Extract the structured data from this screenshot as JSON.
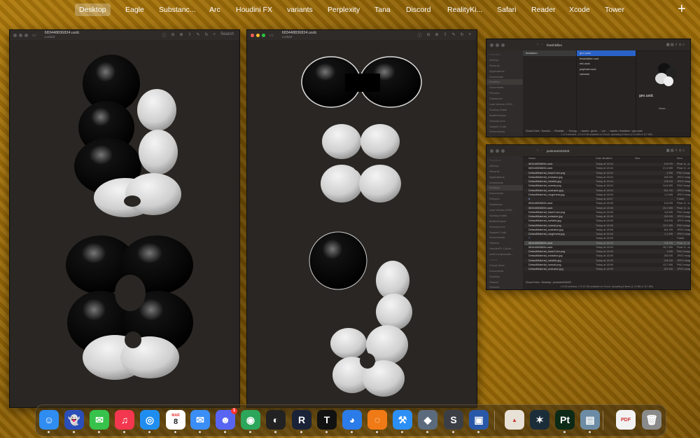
{
  "spaces": [
    {
      "label": "Desktop",
      "active": true
    },
    {
      "label": "Eagle"
    },
    {
      "label": "Substanc..."
    },
    {
      "label": "Arc"
    },
    {
      "label": "Houdini FX"
    },
    {
      "label": "variants"
    },
    {
      "label": "Perplexity"
    },
    {
      "label": "Tana"
    },
    {
      "label": "Discord"
    },
    {
      "label": "RealityKi..."
    },
    {
      "label": "Safari"
    },
    {
      "label": "Reader"
    },
    {
      "label": "Xcode"
    },
    {
      "label": "Tower"
    }
  ],
  "add_space_label": "+",
  "quicklook_left": {
    "title": "683448836834.usdc",
    "subtitle": "Locked",
    "search_placeholder": "Search"
  },
  "quicklook_right": {
    "title": "683448836834.usdc",
    "subtitle": "Locked"
  },
  "finder_top": {
    "title": "fewshkillen",
    "sidebar": [
      "Favorites",
      "AirDrop",
      "Recents",
      "Applications",
      "Downloads",
      "Desktop",
      "Documents",
      "Pictures",
      "Substance",
      "Lata Visdom 2020...",
      "Sunday Hubbi",
      "BubbleHelper",
      "Schools.icns",
      "Sample Code",
      "Screenshots",
      "Stickers",
      "HoudiniFX Cache..."
    ],
    "col1": [
      "fewskken"
    ],
    "col2": [
      "geo.usdc",
      "fewshkillen.usd",
      "mtl.usdc",
      "payload.usdc",
      "variants"
    ],
    "preview_name": "geo.usdc",
    "preview_more": "More...",
    "path": "iCloud Drive › Downlo… › RealityK… › Encryp… › assets › gener… › pxl… › assets › fewskken › geo.usdc",
    "status": "1 of 5 selected, 173.13 GB available on iCloud, Uploading 8 items (1.13 MB of 117 MB)"
  },
  "finder_bottom": {
    "title": "pxstoree343433",
    "sidebar": [
      "Favorites",
      "AirDrop",
      "Recents",
      "Applications",
      "Downloads",
      "Desktop",
      "Documents",
      "Pictures",
      "Substance",
      "Lata Visdom 2020...",
      "Sunday Hubbi",
      "BubbleHelper",
      "Schools.icns",
      "Sample Code",
      "Screenshots",
      "Stickers",
      "HoudiniFX Cache...",
      "swift-composable...",
      "iCloud",
      "iCloud Drive",
      "Documents",
      "Desktop",
      "Shared",
      "Pictures"
    ],
    "headers": [
      "Name",
      "Date Modified",
      "Size",
      "Kind"
    ],
    "rows": [
      {
        "n": "683448836834.usdz",
        "d": "Today at 18:04",
        "s": "100 KB",
        "k": "Pixar U...cument"
      },
      {
        "n": "683448836834.usdc",
        "d": "Today at 18:04",
        "s": "21,3 MB",
        "k": "Pixar U...cument"
      },
      {
        "n": "DefaultMaterial_baseColor.png",
        "d": "Today at 18:04",
        "s": "4 MB",
        "k": "PNG image"
      },
      {
        "n": "DefaultMaterial_emissive.jpg",
        "d": "Today at 18:04",
        "s": "263 KB",
        "k": "JPEG image"
      },
      {
        "n": "DefaultMaterial_metallic.jpg",
        "d": "Today at 18:04",
        "s": "208 KB",
        "k": "JPEG image"
      },
      {
        "n": "DefaultMaterial_normal.png",
        "d": "Today at 18:04",
        "s": "14,6 MB",
        "k": "PNG image"
      },
      {
        "n": "DefaultMaterial_occlusion.jpg",
        "d": "Today at 18:04",
        "s": "841 KB",
        "k": "JPEG image"
      },
      {
        "n": "DefaultMaterial_roughness.jpg",
        "d": "Today at 18:04",
        "s": "1,2 MB",
        "k": "JPEG image"
      },
      {
        "n": "6",
        "d": "Today at 18:07",
        "s": "--",
        "k": "Folder"
      },
      {
        "n": "683448836834.usdz",
        "d": "Today at 18:06",
        "s": "104 KB",
        "k": "Pixar U...cument"
      },
      {
        "n": "683448836834.usdc",
        "d": "Today at 18:06",
        "s": "20,2 MB",
        "k": "Pixar U...cument"
      },
      {
        "n": "DefaultMaterial_baseColor.png",
        "d": "Today at 18:06",
        "s": "3,8 MB",
        "k": "PNG image"
      },
      {
        "n": "DefaultMaterial_emissive.jpg",
        "d": "Today at 18:06",
        "s": "263 KB",
        "k": "JPEG image"
      },
      {
        "n": "DefaultMaterial_metallic.jpg",
        "d": "Today at 18:06",
        "s": "216 KB",
        "k": "JPEG image"
      },
      {
        "n": "DefaultMaterial_normal.png",
        "d": "Today at 18:06",
        "s": "15,2 MB",
        "k": "PNG image"
      },
      {
        "n": "DefaultMaterial_occlusion.jpg",
        "d": "Today at 18:06",
        "s": "811 KB",
        "k": "JPEG image"
      },
      {
        "n": "DefaultMaterial_roughness.jpg",
        "d": "Today at 18:06",
        "s": "1,1 MB",
        "k": "JPEG image"
      },
      {
        "n": "7",
        "d": "Today at 18:09",
        "s": "--",
        "k": "Folder"
      },
      {
        "n": "683448836834.usdc",
        "d": "Today at 18:09",
        "s": "108 KB",
        "k": "Pixar U...cument",
        "sel": true
      },
      {
        "n": "683448836834.usdc",
        "d": "Today at 18:09",
        "s": "18,7 MB",
        "k": "Pixar U...cument"
      },
      {
        "n": "DefaultMaterial_baseColor.png",
        "d": "Today at 18:09",
        "s": "1 MB",
        "k": "PNG image"
      },
      {
        "n": "DefaultMaterial_emissive.jpg",
        "d": "Today at 18:09",
        "s": "263 KB",
        "k": "JPEG image"
      },
      {
        "n": "DefaultMaterial_metallic.jpg",
        "d": "Today at 18:09",
        "s": "206 KB",
        "k": "JPEG image"
      },
      {
        "n": "DefaultMaterial_normal.png",
        "d": "Today at 18:09",
        "s": "13,7 MB",
        "k": "PNG image"
      },
      {
        "n": "DefaultMaterial_occlusion.jpg",
        "d": "Today at 18:09",
        "s": "824 KB",
        "k": "JPEG image"
      }
    ],
    "path": "iCloud Drive › Desktop › pxstoree343433",
    "status": "1 of 53 selected, 173.13 GB available on iCloud, Uploading 8 items (1.13 MB of 117 MB)"
  },
  "dock": [
    {
      "name": "finder",
      "glyph": "☺",
      "color": "#2f8cf0",
      "dot": true
    },
    {
      "name": "ghost-app",
      "glyph": "👻",
      "color": "#2b4fb8",
      "dot": true
    },
    {
      "name": "messages",
      "glyph": "✉",
      "color": "#36c24b",
      "dot": true
    },
    {
      "name": "music",
      "glyph": "♫",
      "color": "#f2374f",
      "dot": true
    },
    {
      "name": "safari",
      "glyph": "◎",
      "color": "#1f8df0",
      "dot": true
    },
    {
      "name": "calendar",
      "glyph": "8",
      "color": "#ffffff",
      "dot": true,
      "month": "MAR"
    },
    {
      "name": "mail",
      "glyph": "✉",
      "color": "#3a8ef6",
      "dot": true
    },
    {
      "name": "discord",
      "glyph": "☻",
      "color": "#5865f2",
      "dot": true,
      "badge": "1"
    },
    {
      "name": "chat-robot",
      "glyph": "◉",
      "color": "#2ba65a",
      "dot": true
    },
    {
      "name": "perplexity",
      "glyph": "◐",
      "color": "#222222",
      "dot": true
    },
    {
      "name": "reader",
      "glyph": "R",
      "color": "#1a2238",
      "dot": true
    },
    {
      "name": "tana",
      "glyph": "T",
      "color": "#111111",
      "dot": true
    },
    {
      "name": "arc",
      "glyph": "◕",
      "color": "#2b7be8",
      "dot": true
    },
    {
      "name": "houdini",
      "glyph": "◌",
      "color": "#f07a16",
      "dot": true
    },
    {
      "name": "xcode",
      "glyph": "⚒",
      "color": "#2c8ff5",
      "dot": true
    },
    {
      "name": "reality-composer",
      "glyph": "◆",
      "color": "#5b6b7d",
      "dot": true
    },
    {
      "name": "sublime",
      "glyph": "S",
      "color": "#3b3f45",
      "dot": true
    },
    {
      "name": "tower",
      "glyph": "▣",
      "color": "#2a58a8",
      "dot": true
    },
    {
      "name": "affinity",
      "glyph": "▲",
      "color": "#e7e1d6",
      "dot": false
    },
    {
      "name": "tower-alt",
      "glyph": "✶",
      "color": "#1c2d3a",
      "dot": false
    },
    {
      "name": "painter",
      "glyph": "Pt",
      "color": "#0c2a16",
      "dot": true
    },
    {
      "name": "preview",
      "glyph": "▤",
      "color": "#6c8ca6",
      "dot": true
    },
    {
      "name": "document",
      "glyph": "PDF",
      "color": "#f2f2f2",
      "dot": false
    },
    {
      "name": "trash",
      "glyph": "🗑",
      "color": "#8a8a8a",
      "dot": false
    }
  ]
}
